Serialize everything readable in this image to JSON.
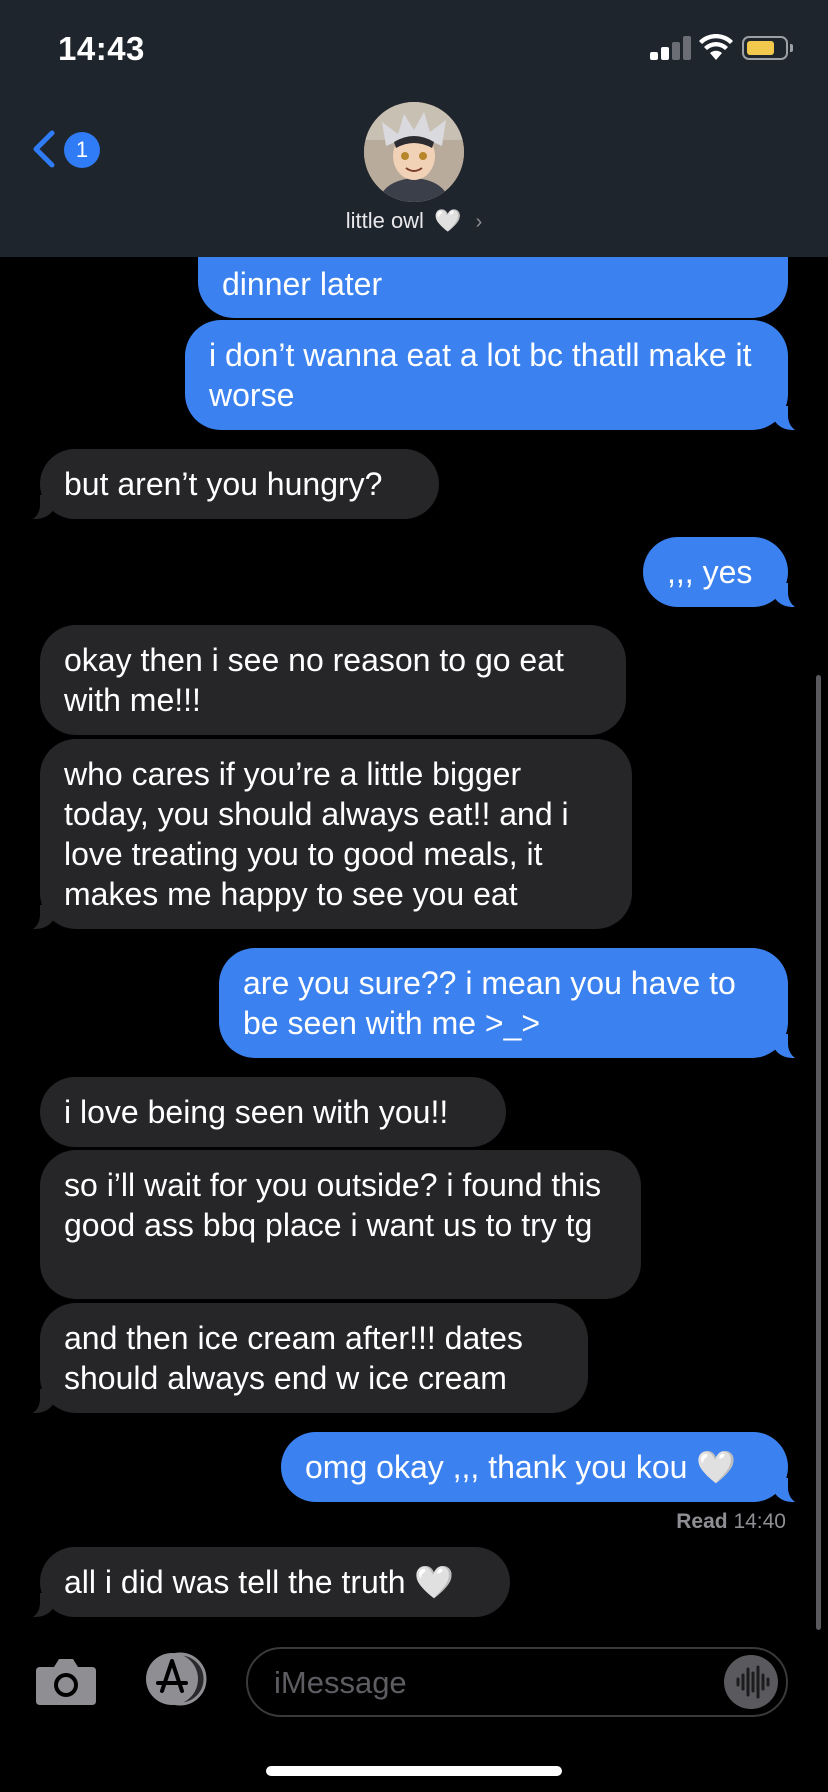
{
  "status_bar": {
    "time": "14:43"
  },
  "header": {
    "back_badge": "1",
    "contact_name": "little owl",
    "contact_heart": "🤍"
  },
  "messages": [
    {
      "from": "me",
      "text": "dinner later"
    },
    {
      "from": "me",
      "text": "i don’t wanna eat a lot bc thatll make it worse"
    },
    {
      "from": "them",
      "text": "but aren’t you hungry?"
    },
    {
      "from": "me",
      "text": ",,, yes"
    },
    {
      "from": "them",
      "text": "okay then i see no reason to go eat with me!!!"
    },
    {
      "from": "them",
      "text": "who cares if you’re a little bigger today, you should always eat!! and i love treating you to good meals, it makes me happy to see you eat"
    },
    {
      "from": "me",
      "text": "are you sure?? i mean you have to be seen with me >_>"
    },
    {
      "from": "them",
      "text": "i love being seen with you!!"
    },
    {
      "from": "them",
      "text": "so i’ll wait for you outside? i found this good ass bbq place i want us to try tg"
    },
    {
      "from": "them",
      "text": "and then ice cream after!!! dates should always end w ice cream"
    },
    {
      "from": "me",
      "text": "omg okay ,,, thank you kou 🤍"
    },
    {
      "from": "them",
      "text": "all i did was tell the truth 🤍"
    }
  ],
  "read_receipt": {
    "label": "Read",
    "time": "14:40"
  },
  "input_bar": {
    "placeholder": "iMessage"
  },
  "colors": {
    "sent_bubble": "#3b82f0",
    "received_bubble": "#262629",
    "accent": "#2f7cf6",
    "header_bg": "#1f252c"
  },
  "icons": [
    "signal-icon",
    "wifi-icon",
    "battery-icon",
    "back-chevron-icon",
    "camera-icon",
    "app-store-icon",
    "audio-waveform-icon"
  ]
}
